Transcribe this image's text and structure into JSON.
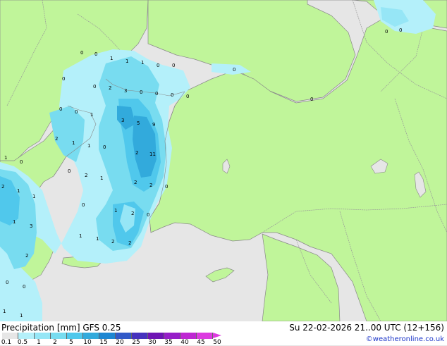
{
  "legend": {
    "title": "Precipitation [mm]  GFS 0.25",
    "datetime": "Su 22-02-2026 21..00 UTC (12+156)",
    "credit": "©weatheronline.co.uk",
    "ticks": [
      "0.1",
      "0.5",
      "1",
      "2",
      "5",
      "10",
      "15",
      "20",
      "25",
      "30",
      "35",
      "40",
      "45",
      "50"
    ],
    "colors": [
      "#e6e6e6",
      "#b4f0fa",
      "#96e6f6",
      "#78dcf0",
      "#50c8ec",
      "#32aadc",
      "#1e87d2",
      "#325ac8",
      "#4632be",
      "#6e14b4",
      "#961ec8",
      "#be28d2",
      "#dc3be0"
    ]
  },
  "map": {
    "colors": {
      "land": "#c0f59a",
      "sea": "#e6e6e6",
      "coast": "#888888",
      "border": "#999999"
    },
    "precip_labels": [
      "0",
      "0",
      "1",
      "1",
      "1",
      "0",
      "0",
      "0",
      "0",
      "0",
      "0",
      "0",
      "2",
      "3",
      "0",
      "0",
      "0",
      "0",
      "0",
      "0",
      "0",
      "1",
      "3",
      "5",
      "9",
      "2",
      "1",
      "1",
      "0",
      "2",
      "11",
      "1",
      "0",
      "2",
      "1",
      "0",
      "2",
      "2",
      "0",
      "2",
      "1",
      "1",
      "0",
      "1",
      "0",
      "1",
      "3",
      "2",
      "1",
      "1",
      "2",
      "2",
      "2",
      "0",
      "0",
      "1",
      "1"
    ]
  }
}
